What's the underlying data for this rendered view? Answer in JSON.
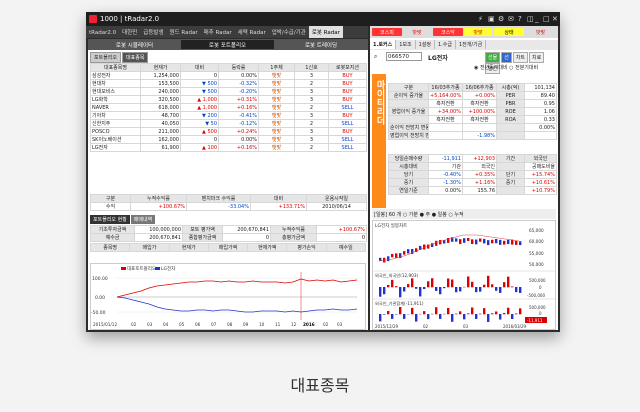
{
  "window": {
    "title": "1000 | tRadar2.0",
    "controls": [
      "⚡",
      "▣",
      "⚙",
      "✉",
      "?",
      "◫",
      "_",
      "□",
      "✕"
    ]
  },
  "menubar": {
    "items": [
      "tRadar2.0",
      "대한민",
      "급등발생",
      "원드 Radar",
      "매추 Radar",
      "세력 Radar",
      "업박/수급/기관",
      "로봇 Radar"
    ],
    "active": 7
  },
  "subtabs": {
    "items": [
      "로봇 시뮬레이터",
      "로봇 포트폴리오",
      "로봇 트레이딩"
    ],
    "active": 1
  },
  "content_tabs": {
    "items": [
      "포트폴리오",
      "대표종목"
    ],
    "active": 1
  },
  "stock_table": {
    "headers": [
      "대표종목명",
      "현재가",
      "대비",
      "등락률",
      "1주체",
      "1신호",
      "로봇포지션"
    ],
    "rows": [
      [
        "삼성전자",
        "1,254,000",
        "0",
        "0.00%",
        "뱃맞",
        "3",
        "BUY"
      ],
      [
        "현대차",
        "153,500",
        "▼ 500",
        "-0.32%",
        "뱃맞",
        "2",
        "BUY"
      ],
      [
        "현대모비스",
        "240,000",
        "▼ 500",
        "-0.20%",
        "뱃맞",
        "3",
        "BUY"
      ],
      [
        "LG화학",
        "320,500",
        "▲ 1,000",
        "+0.31%",
        "뱃맞",
        "3",
        "BUY"
      ],
      [
        "NAVER",
        "618,000",
        "▲ 1,000",
        "+0.16%",
        "뱃맞",
        "2",
        "SELL"
      ],
      [
        "기아차",
        "48,700",
        "▼ 200",
        "-0.41%",
        "뱃맞",
        "3",
        "BUY"
      ],
      [
        "신한지주",
        "40,050",
        "▼ 50",
        "-0.12%",
        "뱃맞",
        "2",
        "SELL"
      ],
      [
        "POSCO",
        "211,000",
        "▲ 500",
        "+0.24%",
        "뱃맞",
        "3",
        "BUY"
      ],
      [
        "SK이노베이션",
        "162,000",
        "0",
        "0.00%",
        "뱃맞",
        "3",
        "SELL"
      ],
      [
        "LG전자",
        "61,900",
        "▲ 100",
        "+0.16%",
        "뱃맞",
        "2",
        "SELL"
      ]
    ]
  },
  "summary": {
    "headers": [
      "구분",
      "누적수익률",
      "벤치마크 수익률",
      "대비",
      "운용시작일"
    ],
    "row": [
      "수익",
      "+100.67%",
      "-33.04%",
      "+133.71%",
      "2010/06/14"
    ]
  },
  "portfolio_tabs": {
    "items": [
      "포트폴리오 현황",
      "매매내역"
    ],
    "active": 0
  },
  "portfolio": {
    "row1": {
      "labels": [
        "기초투자금액",
        "포트 평가액",
        "누적수익률"
      ],
      "values": [
        "100,000,000",
        "200,670,841",
        "+100.67%"
      ]
    },
    "row2": {
      "labels": [
        "예수금",
        "종합평가금액",
        "총평가금액"
      ],
      "values": [
        "200,670,841",
        "0",
        "0"
      ]
    },
    "headers": [
      "종목명",
      "매입가",
      "현재가",
      "매입가액",
      "현재가액",
      "평가손익",
      "예수일"
    ]
  },
  "chart1": {
    "legend": [
      "대표포트폴리오",
      "LG전자"
    ],
    "y_labels": [
      "100.00",
      "0.00",
      "-50.00"
    ],
    "x_labels": [
      "2015/01/12",
      "02",
      "03",
      "04",
      "05",
      "06",
      "07",
      "08",
      "09",
      "10",
      "11",
      "12",
      "2016",
      "02",
      "03"
    ],
    "footer": "300"
  },
  "right_header": {
    "items": [
      "코스피",
      "밧맞",
      "코스닥",
      "밧맞",
      "상태",
      "밧맞"
    ]
  },
  "right_tabs": {
    "items": [
      "1.로커스",
      "1보조",
      "1설정",
      "1.수급",
      "1전개/기금"
    ],
    "active": 0
  },
  "search": {
    "code": "066570",
    "name": "LG전자",
    "buttons": [
      "선물",
      "선",
      "차트",
      "치료",
      "단칸",
      "주세"
    ],
    "options": "◉ 전년동기대비 ○ 전분기대비"
  },
  "vertical_banner": {
    "text": "마이티리더"
  },
  "info": {
    "headers": [
      "구분",
      "16/03추가종",
      "16/06추가종",
      "시총(억)",
      "101,134"
    ],
    "rows": [
      [
        "순이익 증가율",
        "+5,164.00%",
        "+0.00%",
        "PER",
        "89.40"
      ],
      [
        "",
        "흑자전환",
        "흑자전환",
        "PBR",
        "0.95"
      ],
      [
        "영업이익 증가율",
        "+34.00%",
        "+100.00%",
        "ROE",
        "1.06"
      ],
      [
        "",
        "흑자전환",
        "흑자전환",
        "ROA",
        "0.33"
      ],
      [
        "순이익 전망치 변동",
        "",
        "",
        "",
        "0.00%"
      ],
      [
        "영업이익 전망치 변동",
        "",
        "-1.98%",
        "",
        ""
      ]
    ]
  },
  "flow": {
    "headers": [
      "당일순매수량",
      "-11,911",
      "+12,903",
      "기간",
      "외국인"
    ],
    "rows": [
      [
        "시총대비",
        "기관",
        "외국인",
        "",
        "공매도비율"
      ],
      [
        "당기",
        "-0.40%",
        "+0.35%",
        "단기",
        "+15.74%"
      ],
      [
        "중기",
        "-1.30%",
        "+1.16%",
        "중기",
        "+10.61%"
      ],
      [
        "연일기준",
        "0.00%",
        "155.76",
        "",
        "+10.79%"
      ]
    ]
  },
  "chart2": {
    "toolbar": "[일봉] 60 개 ○ 가분 ● 주 ● 일봉 ○ 누적",
    "title": "LG전자 일봉차트",
    "price_labels": [
      "65,000",
      "60,000",
      "55,000",
      "50,000"
    ],
    "vol_label1": "외국인_외국인(12,903)",
    "vol_label2": "외국인_기관합계(-11,911)",
    "vol_vals": [
      "500,000",
      "0",
      "-500,000",
      "500,000",
      "0",
      "-11,911"
    ],
    "x_labels": [
      "2015/12/29",
      "02",
      "03",
      "2016/03/29"
    ],
    "footer": "60"
  },
  "caption": "대표종목",
  "colors": {
    "accent": "#ff8a1a",
    "up": "#d00000",
    "down": "#0047c8"
  }
}
